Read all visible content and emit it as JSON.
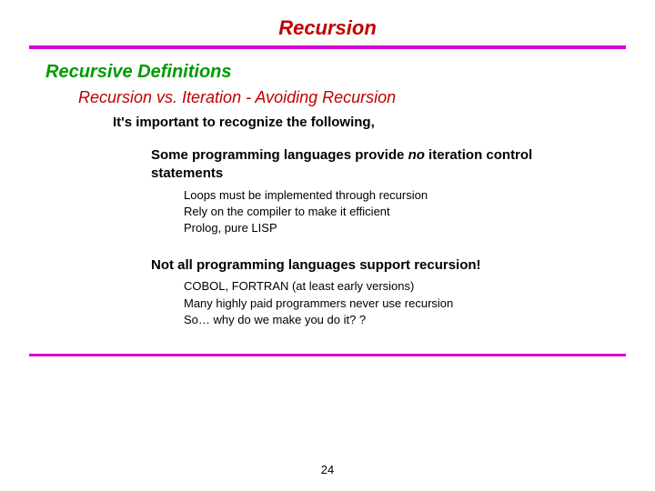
{
  "title": "Recursion",
  "section": "Recursive Definitions",
  "subsection": "Recursion vs. Iteration - Avoiding Recursion",
  "lead": "It's important to recognize the following,",
  "block1": {
    "point_pre": "Some programming languages provide ",
    "point_em": "no",
    "point_post": " iteration control statements",
    "sub1": "Loops must be implemented through recursion",
    "sub2": "Rely on the compiler to make it efficient",
    "sub3": "Prolog, pure LISP"
  },
  "block2": {
    "point": "Not all programming languages support recursion!",
    "sub1": "COBOL, FORTRAN (at least early versions)",
    "sub2": "Many highly paid programmers never use recursion",
    "sub3": "So… why do we make you do it? ?"
  },
  "pagenum": "24"
}
